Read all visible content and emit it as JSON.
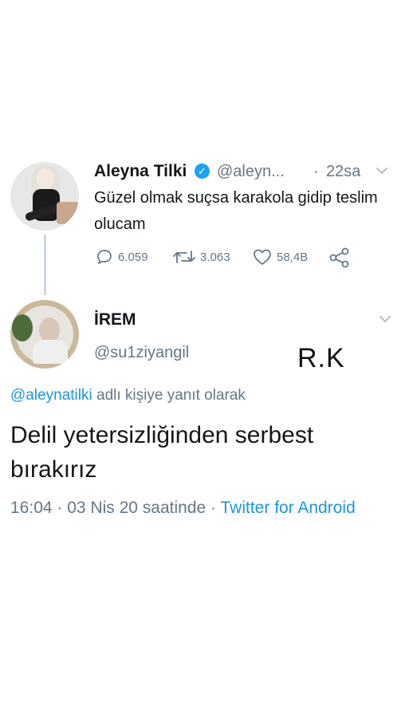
{
  "original_tweet": {
    "author_name": "Aleyna Tilki",
    "handle": "@aleyn...",
    "separator": "·",
    "time": "22sa",
    "text": "Güzel olmak suçsa karakola gidip teslim olucam",
    "reply_count": "6.059",
    "retweet_count": "3.063",
    "like_count": "58,4B",
    "verified_icon": "check-badge-icon",
    "verified_color": "#1da1f2"
  },
  "reply_tweet": {
    "author_name": "İREM",
    "handle": "@su1ziyangil",
    "overlay_text": "R.K",
    "replying_mention": "@aleynatilki",
    "replying_suffix": " adlı kişiye yanıt olarak",
    "text": "Delil yetersizliğinden serbest bırakırız",
    "time": "16:04",
    "separator": "·",
    "date": "03 Nis 20 saatinde",
    "separator2": "·",
    "source": "Twitter for Android"
  },
  "colors": {
    "link": "#1b95e0",
    "muted": "#657786",
    "thread_line": "#ccd6dd"
  }
}
